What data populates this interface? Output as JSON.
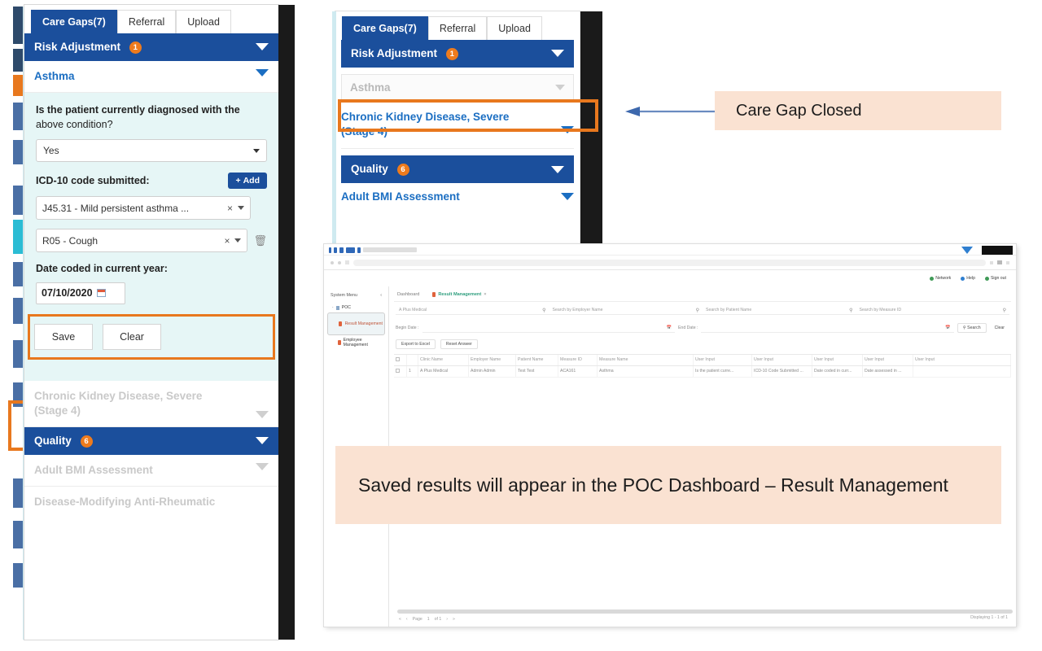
{
  "colors": {
    "primary_blue": "#1b4f9c",
    "link_blue": "#1b6ec2",
    "accent_orange": "#e8781e",
    "badge_orange": "#ee7b1d",
    "callout_peach": "#fae2d2",
    "form_mint": "#e6f6f6",
    "disabled_grey": "#c9c9c9"
  },
  "left_panel": {
    "tabs": [
      {
        "label": "Care Gaps(7)",
        "active": true
      },
      {
        "label": "Referral",
        "active": false
      },
      {
        "label": "Upload",
        "active": false
      }
    ],
    "risk_adjustment": {
      "label": "Risk Adjustment",
      "badge": "1"
    },
    "asthma": {
      "label": "Asthma"
    },
    "question": {
      "bold": "Is the patient currently diagnosed with the",
      "rest": "above condition?"
    },
    "answer_select": {
      "value": "Yes"
    },
    "icd_label": "ICD-10 code submitted:",
    "add_button": "Add",
    "codes": [
      {
        "value": "J45.31 - Mild persistent asthma ..."
      },
      {
        "value": "R05 - Cough"
      }
    ],
    "date_label": "Date coded in current year:",
    "date_value": "07/10/2020",
    "save_button": "Save",
    "clear_button": "Clear",
    "ckd": {
      "label": "Chronic Kidney Disease, Severe (Stage 4)"
    },
    "quality": {
      "label": "Quality",
      "badge": "6"
    },
    "bmi": {
      "label": "Adult BMI Assessment"
    },
    "dmard": {
      "label": "Disease-Modifying Anti-Rheumatic"
    }
  },
  "mid_panel": {
    "tabs": [
      {
        "label": "Care Gaps(7)",
        "active": true
      },
      {
        "label": "Referral",
        "active": false
      },
      {
        "label": "Upload",
        "active": false
      }
    ],
    "risk_adjustment": {
      "label": "Risk Adjustment",
      "badge": "1"
    },
    "asthma_closed": {
      "label": "Asthma"
    },
    "ckd": {
      "label": "Chronic Kidney Disease, Severe (Stage 4)"
    },
    "quality": {
      "label": "Quality",
      "badge": "6"
    },
    "bmi": {
      "label": "Adult BMI Assessment"
    }
  },
  "callouts": {
    "care_gap_closed": "Care Gap Closed",
    "saved_results": "Saved results will appear in the POC Dashboard – Result Management"
  },
  "dashboard": {
    "top_actions": [
      {
        "label": "Network",
        "color": "#3f9a57"
      },
      {
        "label": "Help",
        "color": "#2f7fd0"
      },
      {
        "label": "Sign out",
        "color": "#3f9a57"
      }
    ],
    "sidebar": {
      "title": "System Menu",
      "collapse_icon": "chevron-left-icon",
      "items": [
        {
          "label": "POC",
          "level": 1,
          "selected": false
        },
        {
          "label": "Result Management",
          "level": 2,
          "selected": true
        },
        {
          "label": "Employee Management",
          "level": 2,
          "selected": false
        }
      ]
    },
    "tabs": [
      {
        "label": "Dashboard",
        "active": false
      },
      {
        "label": "Result Management",
        "active": true
      }
    ],
    "search_fields": [
      {
        "placeholder": "A Plus Medical"
      },
      {
        "placeholder": "Search by Employer Name"
      },
      {
        "placeholder": "Search by Patient Name"
      },
      {
        "placeholder": "Search by Measure ID"
      }
    ],
    "date_filters": [
      {
        "label": "Begin Date :"
      },
      {
        "label": "End Date :"
      }
    ],
    "filter_buttons": [
      {
        "label": "Search"
      },
      {
        "label": "Clear"
      }
    ],
    "action_buttons": [
      {
        "label": "Export to Excel"
      },
      {
        "label": "Reset Answer"
      }
    ],
    "table": {
      "headers": [
        "",
        "",
        "Clinic Name",
        "Employer Name",
        "Patient Name",
        "Measure ID",
        "Measure Name",
        "User Input",
        "User Input",
        "User Input",
        "User Input",
        "User Input"
      ],
      "rows": [
        [
          "",
          "1",
          "A Plus Medical",
          "Admin Admin",
          "Test Test",
          "ACA161",
          "Asthma",
          "Is the patient curre...",
          "ICD-10 Code Submitted ...",
          "Date coded in curr...",
          "Date assessed in ...",
          ""
        ]
      ]
    },
    "pagination": {
      "page_label": "Page",
      "page": "1",
      "of_label": "of 1"
    },
    "displaying": "Displaying 1 - 1 of 1"
  }
}
